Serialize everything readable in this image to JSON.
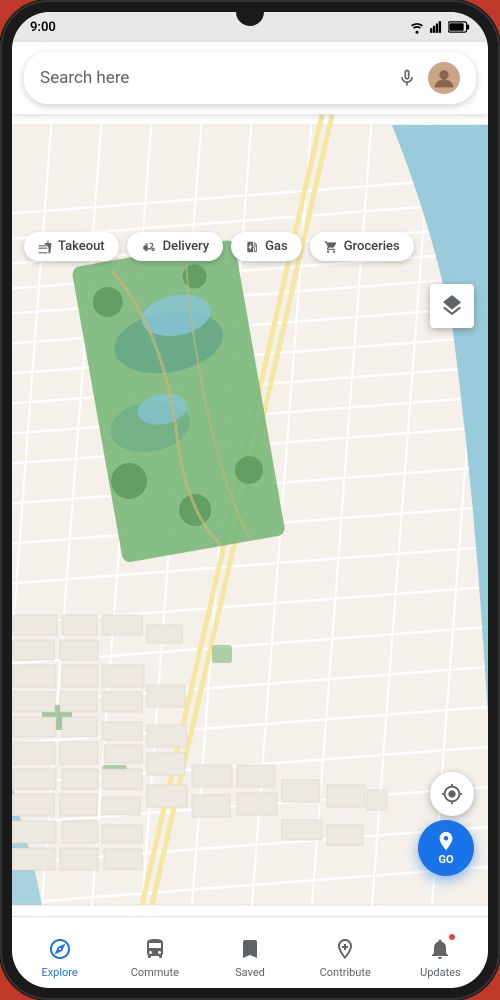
{
  "status_bar": {
    "time": "9:00"
  },
  "search": {
    "placeholder": "Search here",
    "mic_icon": "mic-icon",
    "avatar_icon": "user-avatar"
  },
  "chips": [
    {
      "id": "takeout",
      "label": "Takeout",
      "icon": "takeout"
    },
    {
      "id": "delivery",
      "label": "Delivery",
      "icon": "delivery"
    },
    {
      "id": "gas",
      "label": "Gas",
      "icon": "gas"
    },
    {
      "id": "groceries",
      "label": "Groceries",
      "icon": "groceries"
    }
  ],
  "map": {
    "layer_button": "layers-icon",
    "location_button": "my-location-icon",
    "go_button_label": "GO",
    "go_icon": "directions-icon"
  },
  "bottom_nav": [
    {
      "id": "explore",
      "label": "Explore",
      "icon": "explore-icon",
      "active": true
    },
    {
      "id": "commute",
      "label": "Commute",
      "icon": "commute-icon",
      "active": false
    },
    {
      "id": "saved",
      "label": "Saved",
      "icon": "saved-icon",
      "active": false
    },
    {
      "id": "contribute",
      "label": "Contribute",
      "icon": "contribute-icon",
      "active": false
    },
    {
      "id": "updates",
      "label": "Updates",
      "icon": "updates-icon",
      "active": false,
      "has_notification": true
    }
  ],
  "colors": {
    "accent_blue": "#1a73e8",
    "active_nav": "#1a73e8",
    "inactive_nav": "#5f6368"
  }
}
